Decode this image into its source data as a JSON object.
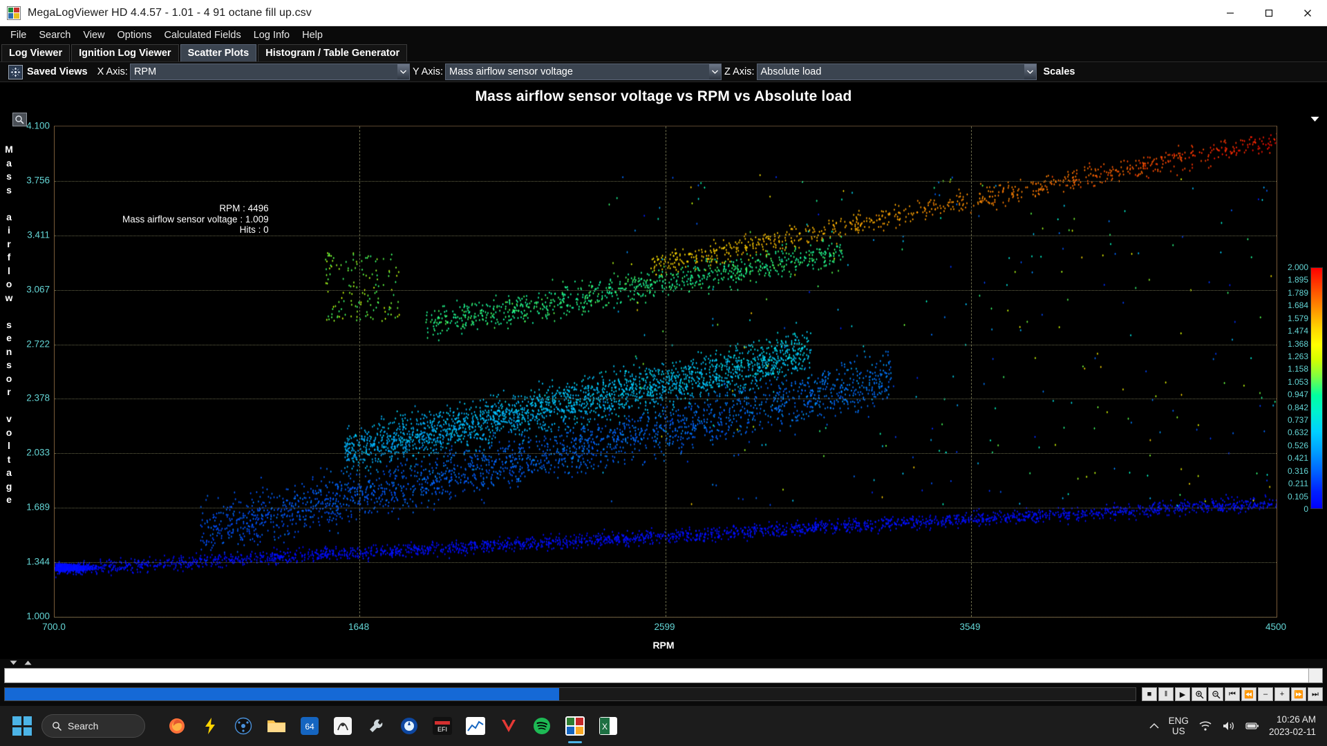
{
  "window": {
    "title": "MegaLogViewer HD 4.4.57 - 1.01 - 4 91 octane fill up.csv",
    "minimize_label": "Minimize",
    "maximize_label": "Maximize",
    "close_label": "Close"
  },
  "menu": {
    "items": [
      {
        "label": "File"
      },
      {
        "label": "Search"
      },
      {
        "label": "View"
      },
      {
        "label": "Options"
      },
      {
        "label": "Calculated Fields"
      },
      {
        "label": "Log Info"
      },
      {
        "label": "Help"
      }
    ]
  },
  "tabs": [
    {
      "label": "Log Viewer",
      "active": false
    },
    {
      "label": "Ignition Log Viewer",
      "active": false
    },
    {
      "label": "Scatter Plots",
      "active": true
    },
    {
      "label": "Histogram / Table Generator",
      "active": false
    }
  ],
  "toolbar": {
    "saved_views_label": "Saved Views",
    "saved_views_icon": "saved-views-icon",
    "x_axis_label": "X Axis:",
    "x_axis_value": "RPM",
    "y_axis_label": "Y Axis:",
    "y_axis_value": "Mass airflow sensor voltage",
    "z_axis_label": "Z Axis:",
    "z_axis_value": "Absolute load",
    "scales_label": "Scales"
  },
  "tooltip": {
    "line1": "RPM : 4496",
    "line2": "Mass airflow sensor voltage : 1.009",
    "line3": "Hits : 0"
  },
  "chart_data": {
    "type": "scatter",
    "title": "Mass airflow sensor voltage vs RPM vs Absolute load",
    "xlabel": "RPM",
    "ylabel": "Mass airflow sensor voltage",
    "zlabel": "Absolute load",
    "xlim": [
      700.0,
      4500
    ],
    "ylim": [
      1.0,
      4.1
    ],
    "zlim": [
      0,
      2.0
    ],
    "grid": true,
    "legend_position": "right",
    "xticks": [
      "700.0",
      "1648",
      "2599",
      "3549",
      "4500"
    ],
    "xtick_values": [
      700.0,
      1648,
      2599,
      3549,
      4500
    ],
    "yticks": [
      "4.100",
      "3.756",
      "3.411",
      "3.067",
      "2.722",
      "2.378",
      "2.033",
      "1.689",
      "1.344",
      "1.000"
    ],
    "ytick_values": [
      4.1,
      3.756,
      3.411,
      3.067,
      2.722,
      2.378,
      2.033,
      1.689,
      1.344,
      1.0
    ],
    "colorbar_ticks": [
      "2.000",
      "1.895",
      "1.789",
      "1.684",
      "1.579",
      "1.474",
      "1.368",
      "1.263",
      "1.158",
      "1.053",
      "0.947",
      "0.842",
      "0.737",
      "0.632",
      "0.526",
      "0.421",
      "0.316",
      "0.211",
      "0.105",
      "0"
    ],
    "colorbar_values": [
      2.0,
      1.895,
      1.789,
      1.684,
      1.579,
      1.474,
      1.368,
      1.263,
      1.158,
      1.053,
      0.947,
      0.842,
      0.737,
      0.632,
      0.526,
      0.421,
      0.316,
      0.211,
      0.105,
      0
    ],
    "point_count_approx": 9000,
    "description": "Dense tri-variate engine log scatter: MAF sensor voltage (Y) rises with RPM (X); point color encodes Absolute load (Z) from blue (0) through cyan/green/yellow to red (2.000). Low-load blue band hugs the bottom from 1.30 V at 700 RPM to ~1.70 V at 4500 RPM; a dense cyan/green cloud spans 2.0-3.1 V between 1600-3000 RPM; a sparse orange/red upper arc climbs from 3.2 V at 2600 RPM to 4.1 V at 4500 RPM."
  },
  "icons": {
    "zoom_tool": "zoom-tool-icon",
    "panel_menu": "panel-menu-caret-icon"
  },
  "transport": {
    "progress_percent": 49,
    "buttons": [
      {
        "name": "stop-button",
        "glyph": "■"
      },
      {
        "name": "pause-button",
        "glyph": "‖"
      },
      {
        "name": "play-button",
        "glyph": "▶"
      },
      {
        "name": "zoom-in-button",
        "glyph": "+"
      },
      {
        "name": "zoom-out-button",
        "glyph": "-"
      },
      {
        "name": "skip-start-button",
        "glyph": "⏮"
      },
      {
        "name": "rewind-button",
        "glyph": "⏪"
      },
      {
        "name": "step-back-button",
        "glyph": "–"
      },
      {
        "name": "step-forward-button",
        "glyph": "+"
      },
      {
        "name": "fast-forward-button",
        "glyph": "⏩"
      },
      {
        "name": "skip-end-button",
        "glyph": "⏭"
      }
    ]
  },
  "taskbar": {
    "search_placeholder": "Search",
    "language": {
      "line1": "ENG",
      "line2": "US"
    },
    "clock": {
      "time": "10:26 AM",
      "date": "2023-02-11"
    },
    "apps": [
      {
        "name": "taskbar-firefox",
        "label": "Firefox"
      },
      {
        "name": "taskbar-flash",
        "label": "Flash Tool"
      },
      {
        "name": "taskbar-tuner",
        "label": "Tuner"
      },
      {
        "name": "taskbar-file-explorer",
        "label": "File Explorer"
      },
      {
        "name": "taskbar-obd",
        "label": "OBD App"
      },
      {
        "name": "taskbar-scan",
        "label": "Scan Tool"
      },
      {
        "name": "taskbar-wrench",
        "label": "Diagnostics"
      },
      {
        "name": "taskbar-ecu",
        "label": "ECU Tool"
      },
      {
        "name": "taskbar-efi",
        "label": "EFI"
      },
      {
        "name": "taskbar-chart",
        "label": "Chart App"
      },
      {
        "name": "taskbar-v",
        "label": "V App"
      },
      {
        "name": "taskbar-spotify",
        "label": "Spotify"
      },
      {
        "name": "taskbar-megalogviewer",
        "label": "MegaLogViewer HD"
      },
      {
        "name": "taskbar-excel",
        "label": "Excel"
      }
    ]
  },
  "colors": {
    "accent": "#4cb4e7",
    "tick_text": "#63d4d4",
    "axis_line": "#7a5c3a",
    "grid": "#6a6a4a",
    "progress": "#1569d6",
    "active_tab_bg": "#3b4450"
  }
}
